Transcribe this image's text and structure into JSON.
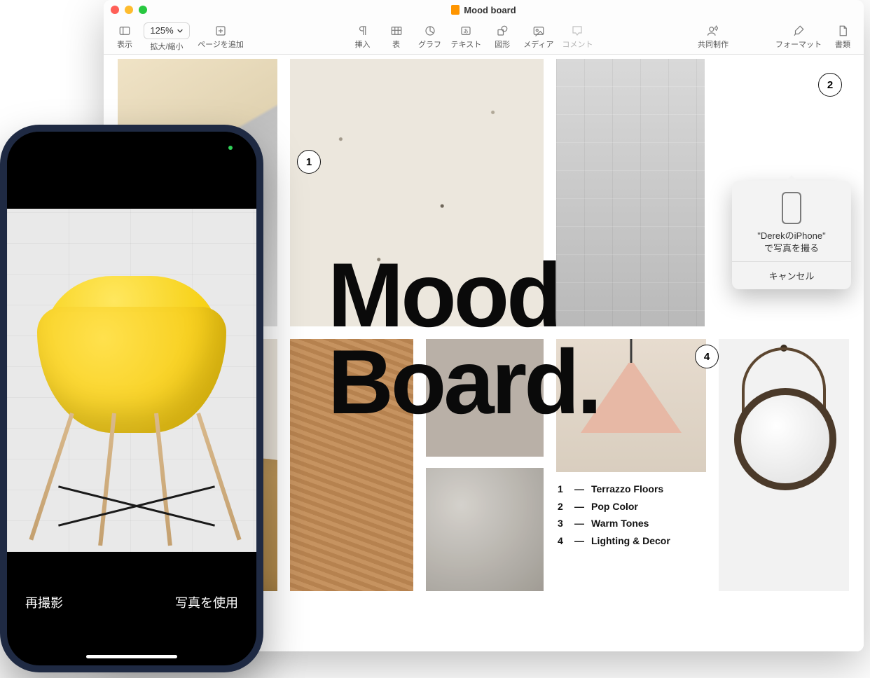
{
  "window": {
    "title": "Mood board"
  },
  "toolbar": {
    "view": "表示",
    "zoom_value": "125%",
    "zoom_label": "拡大/縮小",
    "add_page": "ページを追加",
    "insert": "挿入",
    "table": "表",
    "chart": "グラフ",
    "text": "テキスト",
    "shape": "図形",
    "media": "メディア",
    "comment": "コメント",
    "collaborate": "共同制作",
    "format": "フォーマット",
    "document": "書類"
  },
  "board": {
    "title_line1": "Mood",
    "title_line2": "Board.",
    "callouts": {
      "one": "1",
      "two": "2",
      "four": "4"
    },
    "legend": [
      {
        "n": "1",
        "dash": "—",
        "label": "Terrazzo Floors"
      },
      {
        "n": "2",
        "dash": "—",
        "label": "Pop Color"
      },
      {
        "n": "3",
        "dash": "—",
        "label": "Warm Tones"
      },
      {
        "n": "4",
        "dash": "—",
        "label": "Lighting & Decor"
      }
    ]
  },
  "popover": {
    "line1": "\"DerekのiPhone\"",
    "line2": "で写真を撮る",
    "cancel": "キャンセル"
  },
  "iphone": {
    "retake": "再撮影",
    "use_photo": "写真を使用"
  }
}
